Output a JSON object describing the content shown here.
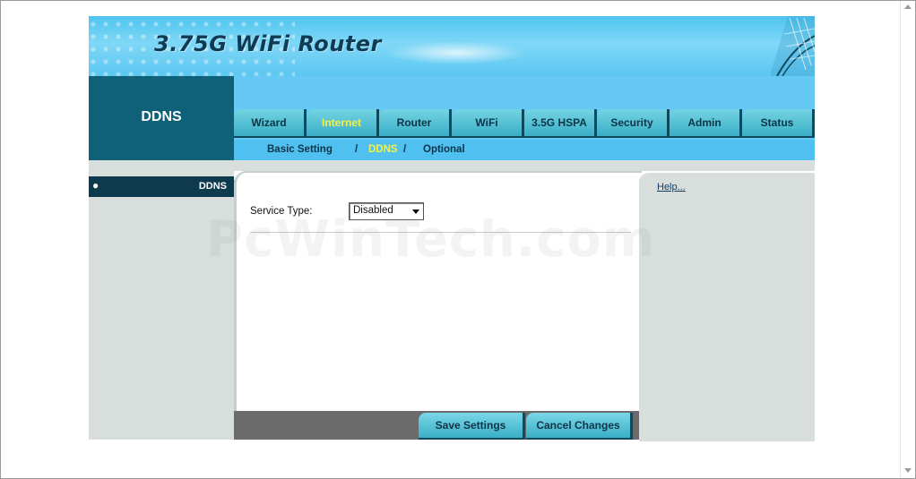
{
  "banner": {
    "title": "3.75G WiFi Router"
  },
  "page": {
    "name": "DDNS"
  },
  "tabs": [
    {
      "label": "Wizard"
    },
    {
      "label": "Internet"
    },
    {
      "label": "Router"
    },
    {
      "label": "WiFi"
    },
    {
      "label": "3.5G HSPA"
    },
    {
      "label": "Security"
    },
    {
      "label": "Admin"
    },
    {
      "label": "Status"
    }
  ],
  "active_tab": "Internet",
  "subnav": {
    "items": [
      "Basic Setting",
      "DDNS",
      "Optional"
    ],
    "separator": "/",
    "current": "DDNS"
  },
  "sidebar": {
    "bullet": "●",
    "items": [
      {
        "label": "DDNS"
      }
    ]
  },
  "form": {
    "service_type_label": "Service Type:",
    "service_type_value": "Disabled"
  },
  "buttons": {
    "save": "Save Settings",
    "cancel": "Cancel Changes"
  },
  "help": {
    "link": "Help..."
  },
  "watermark": "PcWinTech.com",
  "colors": {
    "banner": "#5cc7f1",
    "nav_dark": "#0e6178",
    "tab_active_text": "#f2f24a",
    "panel_gray": "#d7dedc"
  }
}
